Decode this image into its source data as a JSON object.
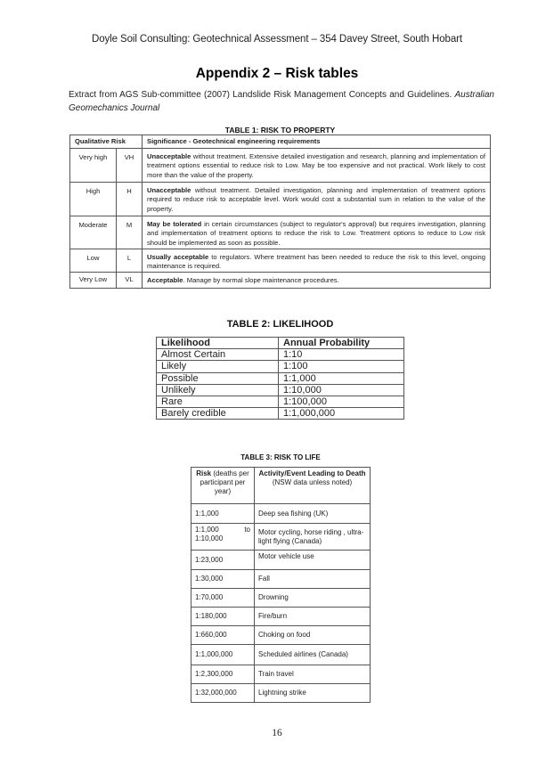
{
  "page": {
    "running_header": "Doyle Soil Consulting: Geotechnical Assessment – 354 Davey Street, South Hobart",
    "title": "Appendix 2 – Risk tables",
    "intro": {
      "text": "Extract from AGS Sub-committee (2007) Landslide Risk Management Concepts and Guidelines.",
      "italic": "Australian Geomechanics Journal"
    },
    "page_number": "16"
  },
  "table1": {
    "caption": "TABLE 1:  RISK TO PROPERTY",
    "headers": [
      "Qualitative Risk",
      "Significance - Geotechnical engineering requirements"
    ],
    "rows": [
      {
        "level": "Very high",
        "code": "VH",
        "bold": "Unacceptable",
        "text": " without treatment.  Extensive detailed investigation and research, planning and implementation of treatment options essential to reduce risk to Low. May be too expensive and not practical.  Work likely to cost more than the value of the property."
      },
      {
        "level": "High",
        "code": "H",
        "bold": "Unacceptable",
        "text": " without treatment. Detailed investigation, planning and implementation of treatment options required to reduce risk to acceptable level.  Work would cost a substantial sum in relation to the value of the property."
      },
      {
        "level": "Moderate",
        "code": "M",
        "bold": "May be tolerated",
        "text": " in certain circumstances (subject to regulator's approval) but requires investigation, planning and implementation of treatment options to reduce the risk to Low. Treatment options to reduce to Low risk should be implemented as soon as possible."
      },
      {
        "level": "Low",
        "code": "L",
        "bold": "Usually acceptable",
        "text": " to regulators. Where treatment has been needed to reduce the risk to this level, ongoing maintenance is required."
      },
      {
        "level": "Very Low",
        "code": "VL",
        "bold": "Acceptable",
        "text": ".  Manage by normal slope maintenance procedures."
      }
    ]
  },
  "table2": {
    "caption": "TABLE 2:  LIKELIHOOD",
    "headers": [
      "Likelihood",
      "Annual Probability"
    ],
    "rows": [
      [
        "Almost Certain",
        "1:10"
      ],
      [
        "Likely",
        "1:100"
      ],
      [
        "Possible",
        "1:1,000"
      ],
      [
        "Unlikely",
        "1:10,000"
      ],
      [
        "Rare",
        "1:100,000"
      ],
      [
        "Barely credible",
        "1:1,000,000"
      ]
    ]
  },
  "table3": {
    "caption": "TABLE 3:  RISK TO LIFE",
    "header_col1_bold": "Risk",
    "header_col1_rest": " (deaths per participant per year)",
    "header_col2_bold": "Activity/Event Leading to Death",
    "header_col2_note": "(NSW data unless noted)",
    "rows": [
      [
        "1:1,000",
        "Deep sea fishing (UK)"
      ],
      [
        "1:1,000 to 1:10,000",
        "Motor cycling, horse riding , ultra-light flying (Canada)"
      ],
      [
        "1:23,000",
        "Motor vehicle use"
      ],
      [
        "1:30,000",
        "Fall"
      ],
      [
        "1:70,000",
        "Drowning"
      ],
      [
        "1:180,000",
        "Fire/burn"
      ],
      [
        "1:660,000",
        "Choking on food"
      ],
      [
        "1:1,000,000",
        "Scheduled airlines (Canada)"
      ],
      [
        "1:2,300,000",
        "Train travel"
      ],
      [
        "1:32,000,000",
        "Lightning strike"
      ]
    ]
  }
}
